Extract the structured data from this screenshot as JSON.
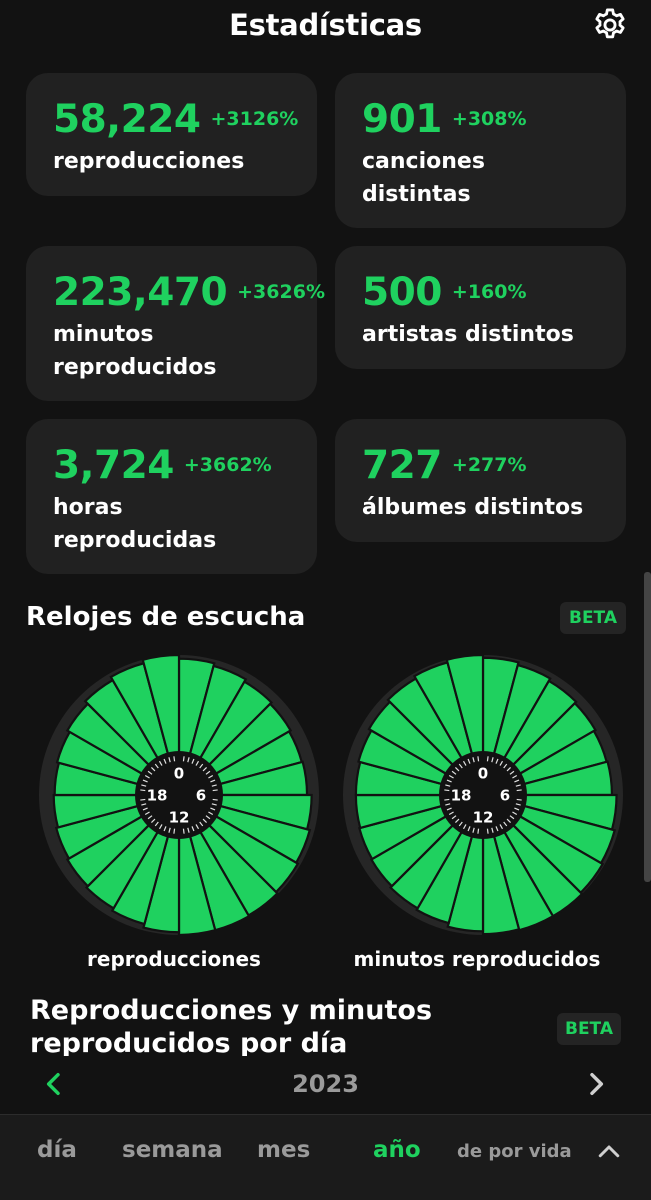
{
  "header": {
    "title": "Estadísticas",
    "settings_icon": "gear-icon"
  },
  "stats": [
    {
      "value": "58,224",
      "delta": "+3126%",
      "label": "reproducciones"
    },
    {
      "value": "901",
      "delta": "+308%",
      "label": "canciones distintas"
    },
    {
      "value": "223,470",
      "delta": "+3626%",
      "label": "minutos reproducidos"
    },
    {
      "value": "500",
      "delta": "+160%",
      "label": "artistas distintos"
    },
    {
      "value": "3,724",
      "delta": "+3662%",
      "label": "horas reproducidas"
    },
    {
      "value": "727",
      "delta": "+277%",
      "label": "álbumes distintos"
    }
  ],
  "clocks_section": {
    "title": "Relojes de escucha",
    "badge": "BETA",
    "clocks": [
      {
        "label": "reproducciones",
        "hour_marks": [
          "0",
          "6",
          "12",
          "18"
        ],
        "hourly_level": [
          0.96,
          0.93,
          0.9,
          0.88,
          0.86,
          0.87,
          0.92,
          0.95,
          0.97,
          0.99,
          1.0,
          1.0,
          0.97,
          0.93,
          0.9,
          0.88,
          0.86,
          0.84,
          0.83,
          0.85,
          0.88,
          0.92,
          0.96,
          1.0
        ]
      },
      {
        "label": "minutos reproducidos",
        "hour_marks": [
          "0",
          "6",
          "12",
          "18"
        ],
        "hourly_level": [
          0.97,
          0.94,
          0.91,
          0.89,
          0.87,
          0.88,
          0.93,
          0.96,
          0.98,
          1.0,
          1.0,
          0.99,
          0.96,
          0.92,
          0.9,
          0.88,
          0.87,
          0.86,
          0.86,
          0.88,
          0.91,
          0.94,
          0.97,
          1.0
        ]
      }
    ]
  },
  "daily_section": {
    "title": "Reproducciones y minutos reproducidos por día",
    "badge": "BETA"
  },
  "year_nav": {
    "year": "2023",
    "prev_icon": "chevron-left-icon",
    "next_icon": "chevron-right-icon"
  },
  "tabs": [
    {
      "label": "día"
    },
    {
      "label": "semana"
    },
    {
      "label": "mes"
    },
    {
      "label": "año",
      "active": true
    },
    {
      "label": "de por vida"
    }
  ],
  "colors": {
    "accent": "#1fd15f",
    "background": "#121212",
    "card": "#212121"
  }
}
